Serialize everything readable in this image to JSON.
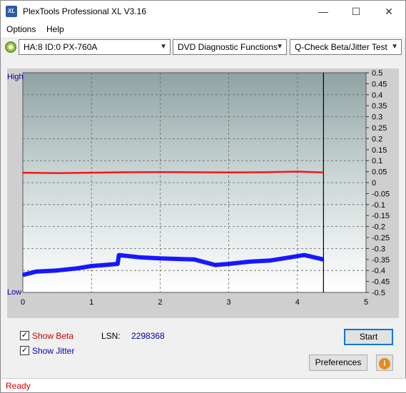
{
  "window": {
    "title": "PlexTools Professional XL V3.16",
    "icon_text": "XL",
    "minimize_glyph": "—",
    "maximize_glyph": "☐",
    "close_glyph": "✕"
  },
  "menu": {
    "items": [
      "Options",
      "Help"
    ]
  },
  "toolbar": {
    "drive_label": "HA:8 ID:0  PX-760A",
    "function_label": "DVD Diagnostic Functions",
    "test_label": "Q-Check Beta/Jitter Test"
  },
  "chart_data": {
    "type": "line",
    "left_axis_labels": {
      "top": "High",
      "bottom": "Low"
    },
    "x_ticks": [
      "0",
      "1",
      "2",
      "3",
      "4",
      "5"
    ],
    "xlim": [
      0,
      5
    ],
    "y_right_ticks": [
      "0.5",
      "0.45",
      "0.4",
      "0.35",
      "0.3",
      "0.25",
      "0.2",
      "0.15",
      "0.1",
      "0.05",
      "0",
      "-0.05",
      "-0.1",
      "-0.15",
      "-0.2",
      "-0.25",
      "-0.3",
      "-0.35",
      "-0.4",
      "-0.45",
      "-0.5"
    ],
    "ylim": [
      -0.5,
      0.5
    ],
    "end_marker_x": 4.38,
    "series": [
      {
        "color": "#ff0000",
        "x": [
          0,
          0.5,
          1,
          1.5,
          2,
          2.5,
          3,
          3.5,
          4,
          4.38
        ],
        "y": [
          0.045,
          0.043,
          0.045,
          0.047,
          0.048,
          0.047,
          0.046,
          0.047,
          0.05,
          0.046
        ]
      },
      {
        "color": "#0000ff",
        "x": [
          0,
          0.2,
          0.5,
          0.8,
          1.0,
          1.2,
          1.38,
          1.4,
          1.7,
          2.0,
          2.5,
          2.8,
          3.0,
          3.3,
          3.6,
          3.9,
          4.1,
          4.38
        ],
        "y": [
          -0.42,
          -0.405,
          -0.4,
          -0.39,
          -0.38,
          -0.375,
          -0.37,
          -0.33,
          -0.34,
          -0.345,
          -0.35,
          -0.375,
          -0.37,
          -0.36,
          -0.355,
          -0.34,
          -0.33,
          -0.35
        ]
      }
    ],
    "grid": true
  },
  "options": {
    "show_beta_label": "Show Beta",
    "show_jitter_label": "Show Jitter",
    "show_beta_checked": true,
    "show_jitter_checked": true,
    "check_glyph": "✓",
    "lsn_label": "LSN:",
    "lsn_value": "2298368"
  },
  "buttons": {
    "start": "Start",
    "preferences": "Preferences",
    "info_glyph": "i"
  },
  "status": {
    "text": "Ready"
  }
}
